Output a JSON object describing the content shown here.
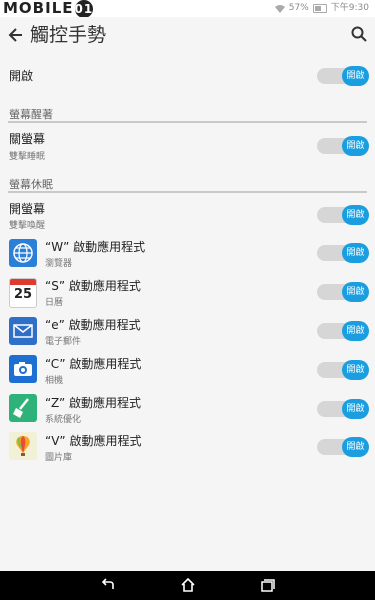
{
  "status": {
    "logo_text": "MOBILE",
    "logo_badge": "01",
    "battery": "57%",
    "time": "下午9:30"
  },
  "header": {
    "title": "觸控手勢"
  },
  "master": {
    "label": "開啟",
    "toggle_label": "開啟"
  },
  "sections": {
    "wake": "螢幕醒著",
    "sleep": "螢幕休眠"
  },
  "screen_off": {
    "label": "關螢幕",
    "sub": "雙擊睡眠",
    "toggle_label": "開啟"
  },
  "screen_on": {
    "label": "開螢幕",
    "sub": "雙擊喚醒",
    "toggle_label": "開啟"
  },
  "apps": [
    {
      "label": "“W” 啟動應用程式",
      "sub": "瀏覽器",
      "toggle_label": "開啟",
      "icon": "browser-globe"
    },
    {
      "label": "“S” 啟動應用程式",
      "sub": "日曆",
      "toggle_label": "開啟",
      "icon": "calendar",
      "icon_text": "25"
    },
    {
      "label": "“e” 啟動應用程式",
      "sub": "電子郵件",
      "toggle_label": "開啟",
      "icon": "email-envelope"
    },
    {
      "label": "“C” 啟動應用程式",
      "sub": "相機",
      "toggle_label": "開啟",
      "icon": "camera"
    },
    {
      "label": "“Z” 啟動應用程式",
      "sub": "系統優化",
      "toggle_label": "開啟",
      "icon": "broom"
    },
    {
      "label": "“V” 啟動應用程式",
      "sub": "圖片庫",
      "toggle_label": "開啟",
      "icon": "gallery-balloon"
    }
  ],
  "colors": {
    "accent": "#1b9ee0",
    "track": "#d6d6d6",
    "background": "#f5f5f5"
  }
}
